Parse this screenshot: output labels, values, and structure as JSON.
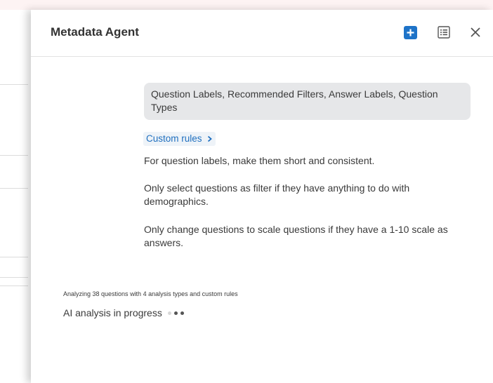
{
  "panel": {
    "title": "Metadata Agent",
    "actions": {
      "add": {
        "icon": "plus-icon",
        "color": "#1e73c8"
      },
      "list": {
        "icon": "list-icon"
      },
      "close": {
        "icon": "close-icon"
      }
    }
  },
  "request": {
    "text": "Question Labels, Recommended Filters, Answer Labels, Question Types"
  },
  "custom_rules": {
    "label": "Custom rules",
    "icon": "chevron-right-icon",
    "rules": [
      "For question labels, make them short and consistent.",
      "Only select questions as filter if they have anything to do with demographics.",
      "Only change questions to scale questions if they have a 1-10 scale as answers."
    ]
  },
  "status": {
    "detail": "Analyzing 38 questions with 4 analysis types and custom rules",
    "main": "AI analysis in progress"
  }
}
